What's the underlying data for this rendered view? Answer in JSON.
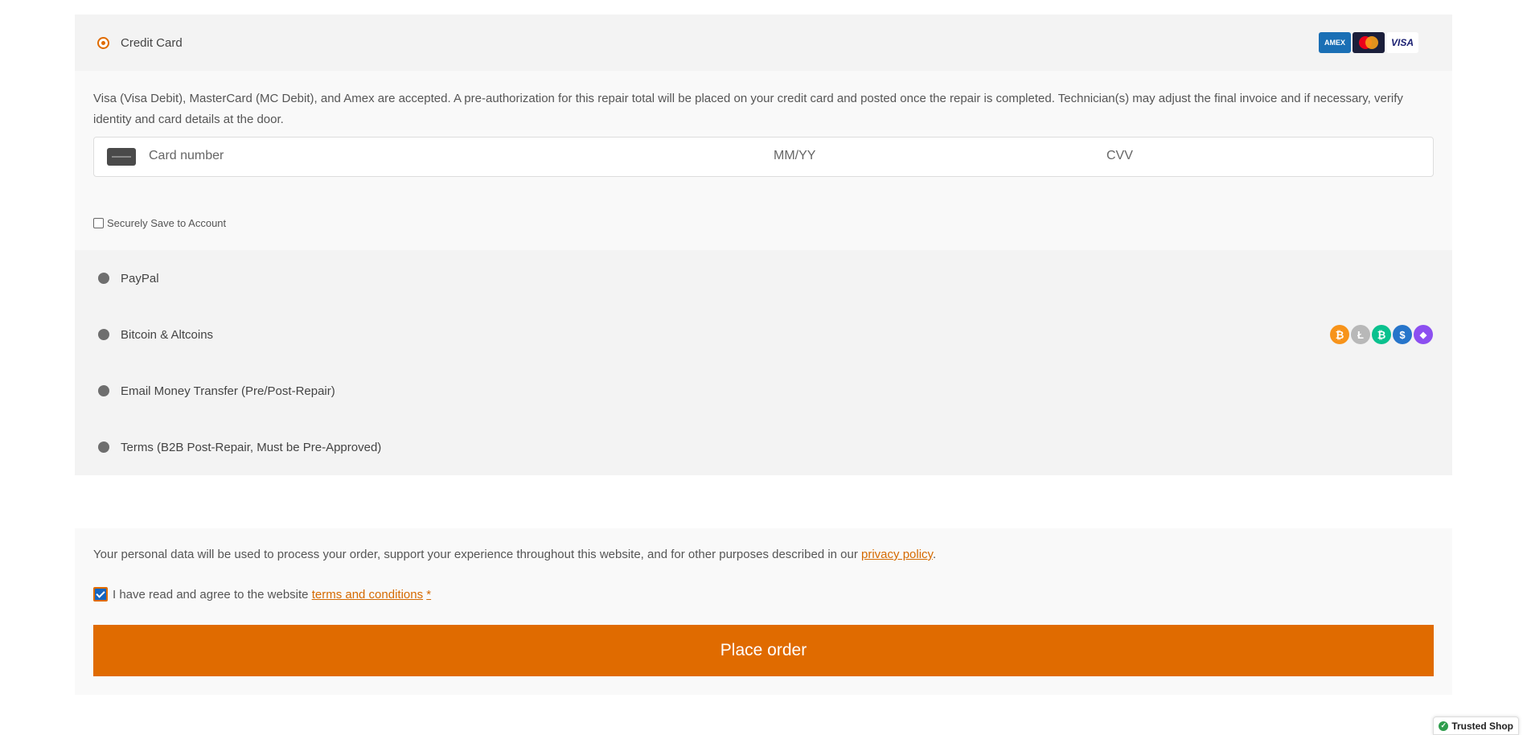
{
  "payment": {
    "credit_card": {
      "label": "Credit Card",
      "selected": true,
      "description": "Visa (Visa Debit), MasterCard (MC Debit), and Amex are accepted. A pre-authorization for this repair total will be placed on your credit card and posted once the repair is completed. Technician(s) may adjust the final invoice and if necessary, verify identity and card details at the door.",
      "card_number_placeholder": "Card number",
      "expiry_placeholder": "MM/YY",
      "cvv_placeholder": "CVV",
      "save_label": "Securely Save to Account",
      "save_checked": false,
      "icons": [
        "amex-icon",
        "mastercard-icon",
        "visa-icon"
      ],
      "visa_text": "VISA"
    },
    "other_methods": [
      {
        "label": "PayPal",
        "selected": false
      },
      {
        "label": "Bitcoin & Altcoins",
        "selected": false
      },
      {
        "label": "Email Money Transfer (Pre/Post-Repair)",
        "selected": false
      },
      {
        "label": "Terms (B2B Post-Repair, Must be Pre-Approved)",
        "selected": false
      }
    ],
    "crypto_icons": [
      {
        "name": "bitcoin-icon",
        "glyph": "₿",
        "color": "#f7931a"
      },
      {
        "name": "litecoin-icon",
        "glyph": "Ł",
        "color": "#b8b8b8"
      },
      {
        "name": "bitcoin-cash-icon",
        "glyph": "₿",
        "color": "#0ac18e"
      },
      {
        "name": "usdc-icon",
        "glyph": "$",
        "color": "#2775ca"
      },
      {
        "name": "ethereum-icon",
        "glyph": "◆",
        "color": "#8c4ff0"
      }
    ]
  },
  "terms": {
    "privacy_text": "Your personal data will be used to process your order, support your experience throughout this website, and for other purposes described in our ",
    "privacy_link": "privacy policy",
    "privacy_end": ".",
    "agree_text": "I have read and agree to the website ",
    "terms_link": "terms and conditions",
    "required_mark": "*",
    "agree_checked": true
  },
  "place_order_label": "Place order",
  "trusted_badge": "Trusted Shop",
  "colors": {
    "accent": "#e06b00",
    "panel": "#f3f3f3",
    "panel_light": "#f9f9f9"
  }
}
